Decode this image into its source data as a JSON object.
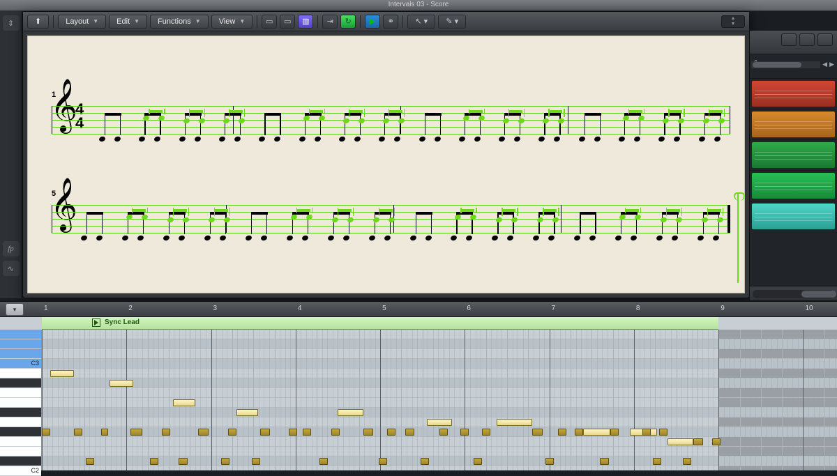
{
  "window_title": "Intervals 03 - Score",
  "toolbar": {
    "back_icon": "back-arrow",
    "menus": [
      "Layout",
      "Edit",
      "Functions",
      "View"
    ],
    "icons": [
      "segment-a",
      "segment-b",
      "segment-c-active",
      "midi-in",
      "midi-out-active",
      "filter-active",
      "link",
      "pointer",
      "pencil"
    ],
    "stepper": "±"
  },
  "left_strip": {
    "icons": [
      "up-down",
      "dynamics-fp",
      "ornament"
    ]
  },
  "score": {
    "systems": [
      {
        "bar_number": 1,
        "time_sig_top": "4",
        "time_sig_bot": "4",
        "bars": 4
      },
      {
        "bar_number": 5,
        "bars": 4
      }
    ]
  },
  "top_right": {
    "icons": [
      "list",
      "properties",
      "mixer"
    ],
    "ruler_label": "8",
    "tracks": [
      "red",
      "orange",
      "green1",
      "green2",
      "teal"
    ]
  },
  "piano_roll": {
    "ruler": [
      1,
      2,
      3,
      4,
      5,
      6,
      7,
      8,
      9,
      10
    ],
    "region_name": "Sync Lead",
    "region_bars_start": 1,
    "region_bars_end": 9,
    "key_labels": {
      "C3": "C3",
      "C2": "C2"
    },
    "notes": [
      {
        "row": 4,
        "start": 0.1,
        "len": 0.28,
        "sel": false
      },
      {
        "row": 5,
        "start": 0.8,
        "len": 0.28,
        "sel": false
      },
      {
        "row": 7,
        "start": 1.55,
        "len": 0.26,
        "sel": false
      },
      {
        "row": 8,
        "start": 2.3,
        "len": 0.26,
        "sel": false
      },
      {
        "row": 8,
        "start": 3.5,
        "len": 0.3,
        "sel": false
      },
      {
        "row": 9,
        "start": 4.55,
        "len": 0.3,
        "sel": false
      },
      {
        "row": 9,
        "start": 5.38,
        "len": 0.42,
        "sel": false
      },
      {
        "row": 10,
        "start": 6.4,
        "len": 0.32,
        "sel": false
      },
      {
        "row": 10,
        "start": 6.95,
        "len": 0.32,
        "sel": false
      },
      {
        "row": 11,
        "start": 7.4,
        "len": 0.3,
        "sel": false
      },
      {
        "row": 10,
        "start": 0.0,
        "len": 0.1,
        "sel": true
      },
      {
        "row": 10,
        "start": 0.38,
        "len": 0.1,
        "sel": true
      },
      {
        "row": 10,
        "start": 0.7,
        "len": 0.08,
        "sel": true
      },
      {
        "row": 10,
        "start": 1.05,
        "len": 0.14,
        "sel": true
      },
      {
        "row": 13,
        "start": 0.52,
        "len": 0.1,
        "sel": true
      },
      {
        "row": 13,
        "start": 1.28,
        "len": 0.1,
        "sel": true
      },
      {
        "row": 10,
        "start": 1.42,
        "len": 0.1,
        "sel": true
      },
      {
        "row": 10,
        "start": 1.85,
        "len": 0.12,
        "sel": true
      },
      {
        "row": 13,
        "start": 1.62,
        "len": 0.1,
        "sel": true
      },
      {
        "row": 13,
        "start": 2.12,
        "len": 0.1,
        "sel": true
      },
      {
        "row": 10,
        "start": 2.2,
        "len": 0.1,
        "sel": true
      },
      {
        "row": 10,
        "start": 2.58,
        "len": 0.12,
        "sel": true
      },
      {
        "row": 10,
        "start": 2.92,
        "len": 0.1,
        "sel": true
      },
      {
        "row": 13,
        "start": 2.48,
        "len": 0.1,
        "sel": true
      },
      {
        "row": 10,
        "start": 3.08,
        "len": 0.1,
        "sel": true
      },
      {
        "row": 10,
        "start": 3.42,
        "len": 0.1,
        "sel": true
      },
      {
        "row": 13,
        "start": 3.28,
        "len": 0.1,
        "sel": true
      },
      {
        "row": 10,
        "start": 3.8,
        "len": 0.12,
        "sel": true
      },
      {
        "row": 10,
        "start": 4.08,
        "len": 0.1,
        "sel": true
      },
      {
        "row": 13,
        "start": 3.98,
        "len": 0.1,
        "sel": true
      },
      {
        "row": 10,
        "start": 4.3,
        "len": 0.1,
        "sel": true
      },
      {
        "row": 10,
        "start": 4.7,
        "len": 0.1,
        "sel": true
      },
      {
        "row": 13,
        "start": 4.48,
        "len": 0.1,
        "sel": true
      },
      {
        "row": 10,
        "start": 4.95,
        "len": 0.1,
        "sel": true
      },
      {
        "row": 10,
        "start": 5.2,
        "len": 0.1,
        "sel": true
      },
      {
        "row": 13,
        "start": 5.1,
        "len": 0.1,
        "sel": true
      },
      {
        "row": 10,
        "start": 5.8,
        "len": 0.12,
        "sel": true
      },
      {
        "row": 10,
        "start": 6.1,
        "len": 0.1,
        "sel": true
      },
      {
        "row": 13,
        "start": 5.95,
        "len": 0.1,
        "sel": true
      },
      {
        "row": 10,
        "start": 6.3,
        "len": 0.1,
        "sel": true
      },
      {
        "row": 10,
        "start": 6.72,
        "len": 0.1,
        "sel": true
      },
      {
        "row": 13,
        "start": 6.6,
        "len": 0.1,
        "sel": true
      },
      {
        "row": 10,
        "start": 7.1,
        "len": 0.1,
        "sel": true
      },
      {
        "row": 10,
        "start": 7.3,
        "len": 0.1,
        "sel": true
      },
      {
        "row": 13,
        "start": 7.22,
        "len": 0.1,
        "sel": true
      },
      {
        "row": 11,
        "start": 7.7,
        "len": 0.12,
        "sel": true
      },
      {
        "row": 13,
        "start": 7.58,
        "len": 0.1,
        "sel": true
      },
      {
        "row": 11,
        "start": 7.92,
        "len": 0.1,
        "sel": true
      }
    ]
  }
}
